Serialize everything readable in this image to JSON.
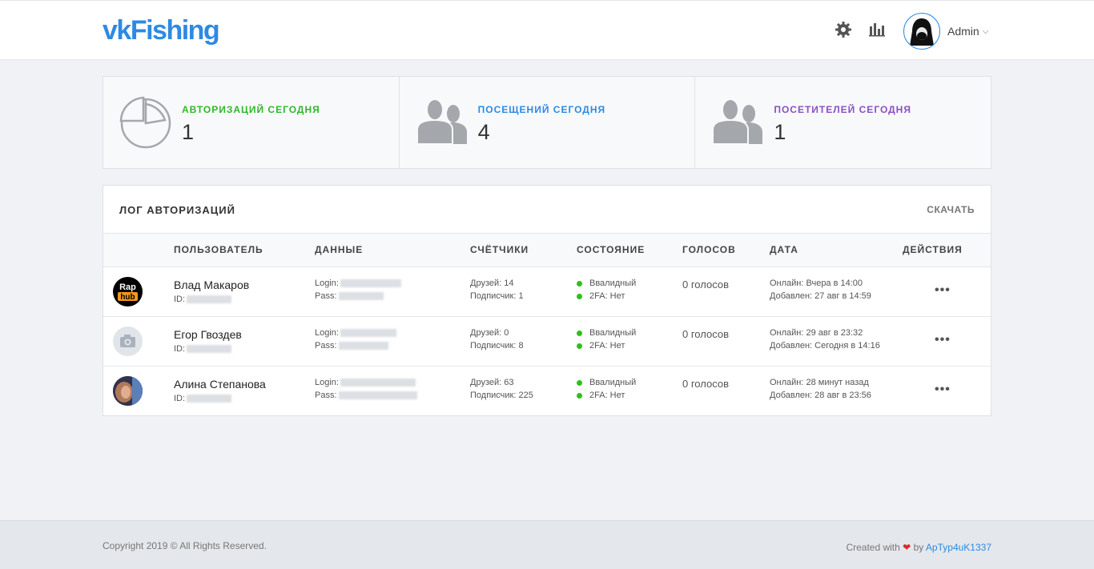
{
  "header": {
    "logo": "vkFishing",
    "user_name": "Admin"
  },
  "stats": [
    {
      "label": "АВТОРИЗАЦИЙ СЕГОДНЯ",
      "value": "1",
      "color": "#2eb82a"
    },
    {
      "label": "ПОСЕЩЕНИЙ СЕГОДНЯ",
      "value": "4",
      "color": "#2d8ae4"
    },
    {
      "label": "ПОСЕТИТЕЛЕЙ СЕГОДНЯ",
      "value": "1",
      "color": "#8a4fc4"
    }
  ],
  "log": {
    "title": "ЛОГ АВТОРИЗАЦИЙ",
    "download": "СКАЧАТЬ",
    "columns": [
      "ПОЛЬЗОВАТЕЛЬ",
      "ДАННЫЕ",
      "СЧЁТЧИКИ",
      "СОСТОЯНИЕ",
      "ГОЛОСОВ",
      "ДАТА",
      "ДЕЙСТВИЯ"
    ],
    "rows": [
      {
        "name": "Влад Макаров",
        "id_label": "ID:",
        "login_label": "Login:",
        "pass_label": "Pass:",
        "friends": "Друзей: 14",
        "followers": "Подписчик: 1",
        "status_valid": "Ввалидный",
        "status_2fa": "2FA: Нет",
        "votes": "0 голосов",
        "online": "Онлайн: Вчера в 14:00",
        "added": "Добавлен: 27 авг в 14:59",
        "avatar_type": "rap"
      },
      {
        "name": "Егор Гвоздев",
        "id_label": "ID:",
        "login_label": "Login:",
        "pass_label": "Pass:",
        "friends": "Друзей: 0",
        "followers": "Подписчик: 8",
        "status_valid": "Ввалидный",
        "status_2fa": "2FA: Нет",
        "votes": "0 голосов",
        "online": "Онлайн: 29 авг в 23:32",
        "added": "Добавлен: Сегодня в 14:16",
        "avatar_type": "camera"
      },
      {
        "name": "Алина Степанова",
        "id_label": "ID:",
        "login_label": "Login:",
        "pass_label": "Pass:",
        "friends": "Друзей: 63",
        "followers": "Подписчик: 225",
        "status_valid": "Ввалидный",
        "status_2fa": "2FA: Нет",
        "votes": "0 голосов",
        "online": "Онлайн: 28 минут назад",
        "added": "Добавлен: 28 авг в 23:56",
        "avatar_type": "photo"
      }
    ],
    "action_label": "•••",
    "avatar_logo": {
      "line1": "Rap",
      "line2": "hub"
    }
  },
  "footer": {
    "copyright": "Copyright 2019 © All Rights Reserved.",
    "created_prefix": "Created with",
    "heart": "❤",
    "created_by": "by",
    "author": "ApTyp4uK1337"
  },
  "icons": {
    "settings": "gear-icon",
    "stats": "bar-chart-icon",
    "caret": "chevron-down-icon",
    "auth": "pie-chart-icon",
    "visits": "users-icon",
    "visitors": "users-icon"
  }
}
